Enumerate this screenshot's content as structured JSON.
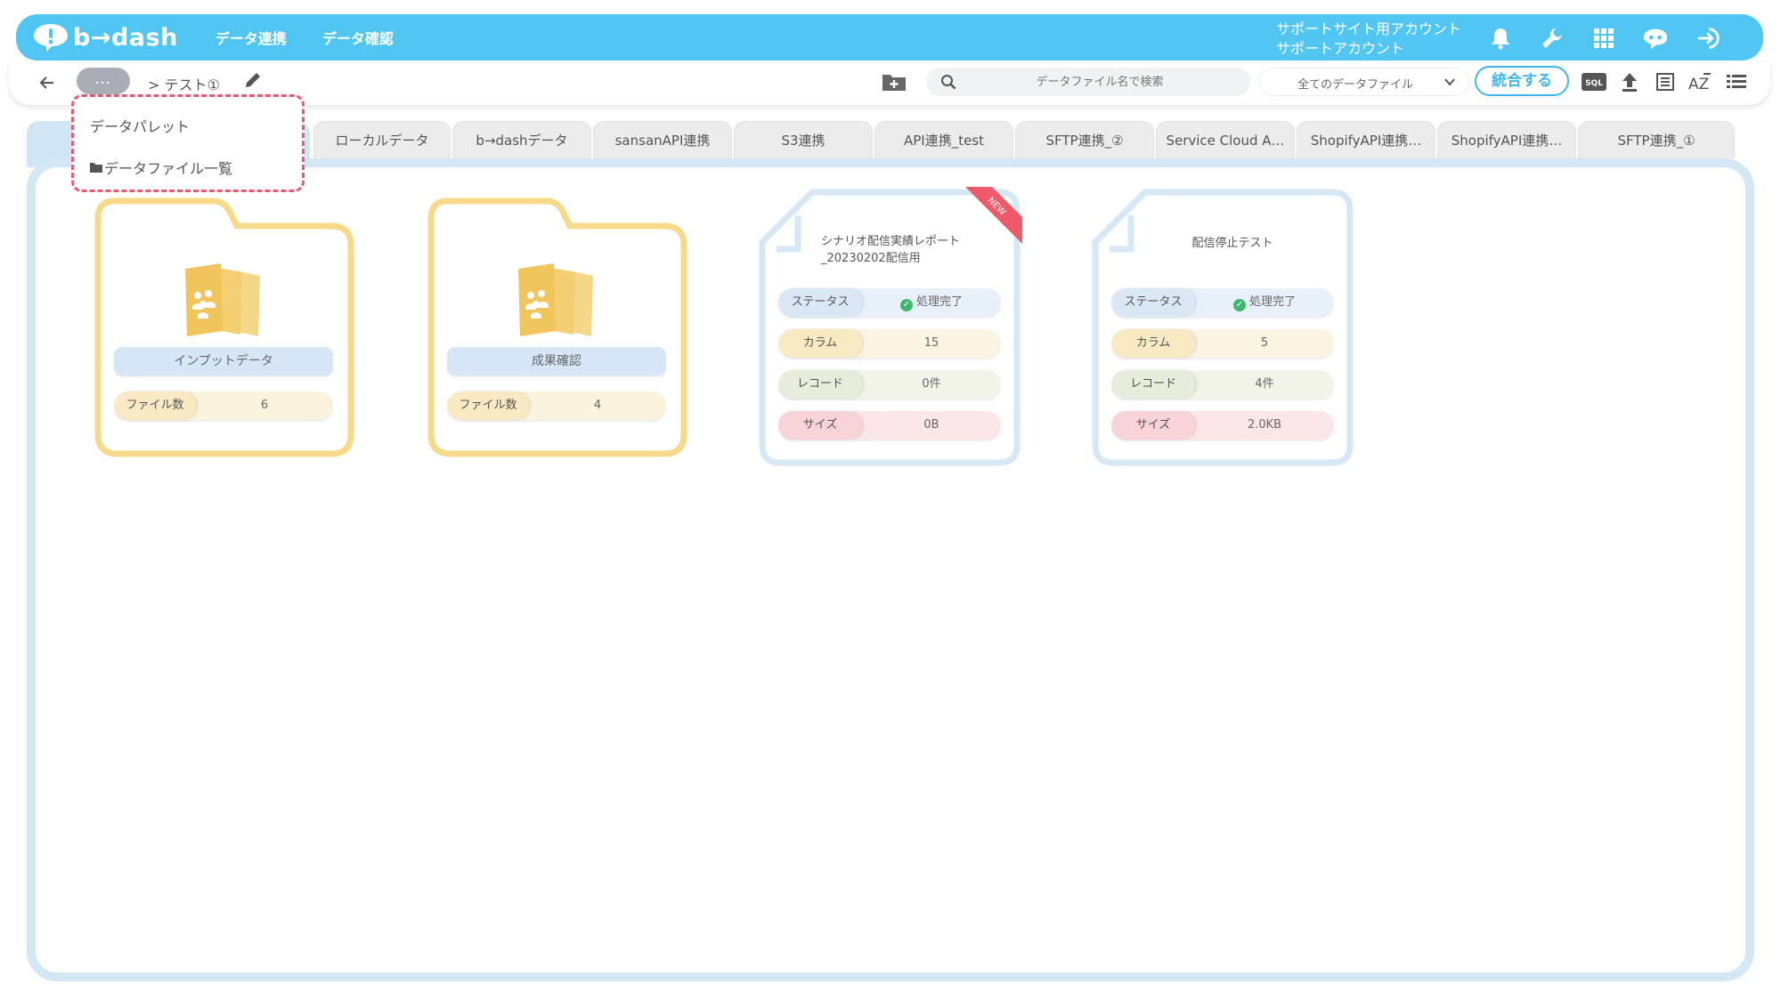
{
  "app": {
    "logo_text": "b→dash",
    "nav": [
      "データ連携",
      "データ確認"
    ],
    "account_line1": "サポートサイト用アカウント",
    "account_line2": "サポートアカウント",
    "header_icons": [
      "bell-icon",
      "wrench-icon",
      "grid-icon",
      "chat-robot-icon",
      "logout-icon"
    ]
  },
  "toolbar": {
    "back_icon": "arrow-left-icon",
    "breadcrumb_more": "…",
    "breadcrumb_current": "> テスト①",
    "edit_icon": "pencil-icon",
    "new_folder_icon": "folder-plus-icon",
    "search_placeholder": "データファイル名で検索",
    "filter_selected": "全てのデータファイル",
    "merge_label": "統合する",
    "right_icons": [
      "sql-icon",
      "upload-icon",
      "list-detail-icon",
      "sort-az-icon",
      "list-icon"
    ]
  },
  "dropdown": {
    "items": [
      "データパレット",
      "データファイル一覧"
    ]
  },
  "tabs": [
    "ローカルデータ",
    "b→dashデータ",
    "sansanAPI連携",
    "S3連携",
    "API連携_test",
    "SFTP連携_②",
    "Service Cloud A…",
    "ShopifyAPI連携…",
    "ShopifyAPI連携…",
    "SFTP連携_①"
  ],
  "folders": [
    {
      "name": "インプットデータ",
      "file_count_label": "ファイル数",
      "file_count": "6"
    },
    {
      "name": "成果確認",
      "file_count_label": "ファイル数",
      "file_count": "4"
    }
  ],
  "files": [
    {
      "title": "シナリオ配信実績レポート_20230202配信用",
      "badge": "NEW",
      "status_label": "ステータス",
      "status_value": "処理完了",
      "column_label": "カラム",
      "column_value": "15",
      "record_label": "レコード",
      "record_value": "0件",
      "size_label": "サイズ",
      "size_value": "0B"
    },
    {
      "title": "配信停止テスト",
      "status_label": "ステータス",
      "status_value": "処理完了",
      "column_label": "カラム",
      "column_value": "5",
      "record_label": "レコード",
      "record_value": "4件",
      "size_label": "サイズ",
      "size_value": "2.0KB"
    }
  ],
  "colors": {
    "header": "#52c6f3",
    "accent": "#41b6ea",
    "folder": "#f7d98a",
    "file_border": "#d6e8f6",
    "highlight": "#e85a72"
  }
}
